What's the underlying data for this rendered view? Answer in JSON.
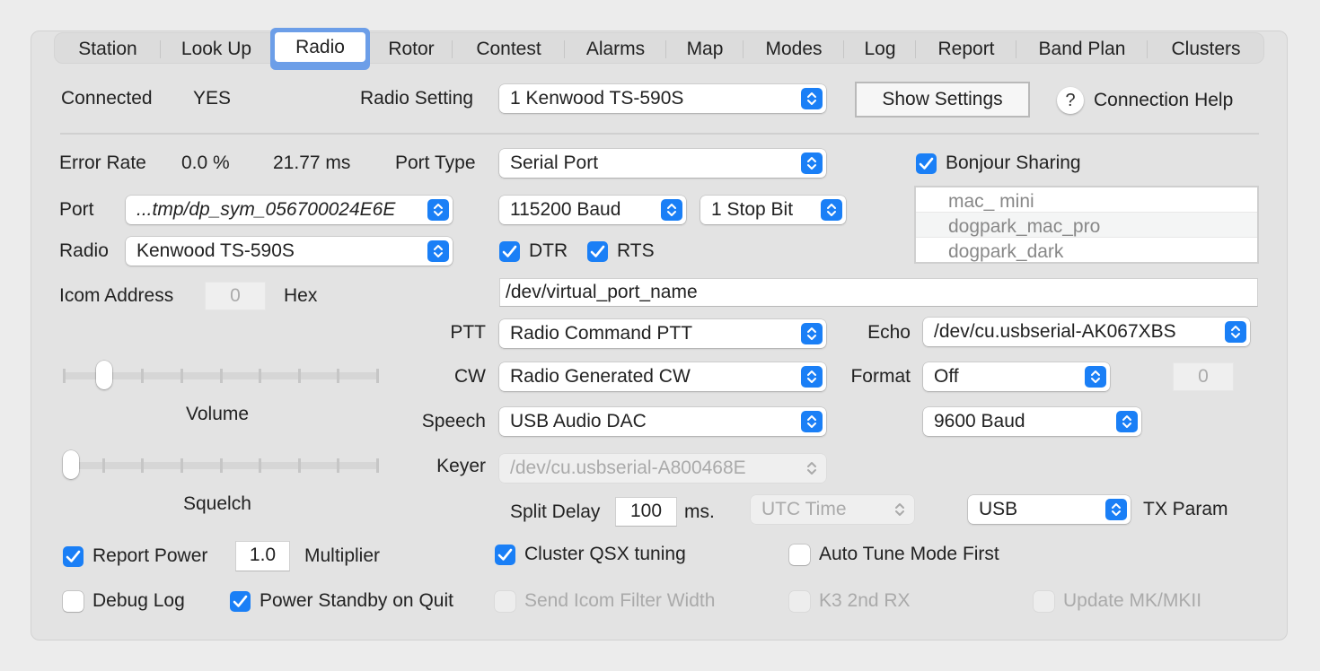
{
  "tabs": [
    {
      "label": "Station",
      "active": false
    },
    {
      "label": "Look Up",
      "active": false
    },
    {
      "label": "Radio",
      "active": true
    },
    {
      "label": "Rotor",
      "active": false
    },
    {
      "label": "Contest",
      "active": false
    },
    {
      "label": "Alarms",
      "active": false
    },
    {
      "label": "Map",
      "active": false
    },
    {
      "label": "Modes",
      "active": false
    },
    {
      "label": "Log",
      "active": false
    },
    {
      "label": "Report",
      "active": false
    },
    {
      "label": "Band Plan",
      "active": false
    },
    {
      "label": "Clusters",
      "active": false
    }
  ],
  "header": {
    "connected_label": "Connected",
    "connected_value": "YES",
    "radio_setting_label": "Radio Setting",
    "radio_setting_value": "1 Kenwood TS-590S",
    "show_settings_label": "Show Settings",
    "help_icon": "?",
    "connection_help_label": "Connection Help"
  },
  "status": {
    "error_rate_label": "Error Rate",
    "error_rate_value": "0.0 %",
    "latency_value": "21.77 ms"
  },
  "port": {
    "port_type_label": "Port Type",
    "port_type_value": "Serial Port",
    "port_label": "Port",
    "port_value": "...tmp/dp_sym_056700024E6E",
    "baud_value": "115200 Baud",
    "stop_bits_value": "1 Stop Bit",
    "radio_label": "Radio",
    "radio_value": "Kenwood TS-590S",
    "dtr_label": "DTR",
    "dtr_checked": true,
    "rts_label": "RTS",
    "rts_checked": true,
    "icom_address_label": "Icom Address",
    "icom_address_value": "0",
    "hex_label": "Hex",
    "virtual_port_value": "/dev/virtual_port_name"
  },
  "bonjour": {
    "label": "Bonjour Sharing",
    "checked": true,
    "hosts": [
      "mac_ mini",
      "dogpark_mac_pro",
      "dogpark_dark"
    ]
  },
  "sliders": {
    "volume_label": "Volume",
    "volume_fraction": 0.11,
    "squelch_label": "Squelch",
    "squelch_fraction": 0.0
  },
  "controls": {
    "ptt_label": "PTT",
    "ptt_value": "Radio Command PTT",
    "echo_label": "Echo",
    "echo_value": "/dev/cu.usbserial-AK067XBS",
    "cw_label": "CW",
    "cw_value": "Radio Generated CW",
    "format_label": "Format",
    "format_value": "Off",
    "format_number": "0",
    "speech_label": "Speech",
    "speech_value": "USB Audio DAC",
    "echo_baud_value": "9600 Baud",
    "keyer_label": "Keyer",
    "keyer_value": "/dev/cu.usbserial-A800468E",
    "split_delay_label": "Split Delay",
    "split_delay_value": "100",
    "split_delay_unit": "ms.",
    "time_value": "UTC Time",
    "tx_mode_value": "USB",
    "tx_param_label": "TX Param"
  },
  "options": {
    "report_power_label": "Report Power",
    "report_power_checked": true,
    "multiplier_value": "1.0",
    "multiplier_label": "Multiplier",
    "cluster_qsx_label": "Cluster QSX tuning",
    "cluster_qsx_checked": true,
    "auto_tune_label": "Auto Tune Mode First",
    "auto_tune_checked": false,
    "debug_log_label": "Debug Log",
    "debug_log_checked": false,
    "power_standby_label": "Power Standby on Quit",
    "power_standby_checked": true,
    "send_icom_filter_label": "Send Icom Filter Width",
    "send_icom_filter_checked": false,
    "k3_2nd_rx_label": "K3 2nd RX",
    "k3_2nd_rx_checked": false,
    "update_mk_label": "Update MK/MKII",
    "update_mk_checked": false
  },
  "colors": {
    "accent": "#1a7ff6",
    "focus_ring": "#6c9ee8",
    "panel_bg": "#e3e3e3",
    "window_bg": "#ececec"
  }
}
